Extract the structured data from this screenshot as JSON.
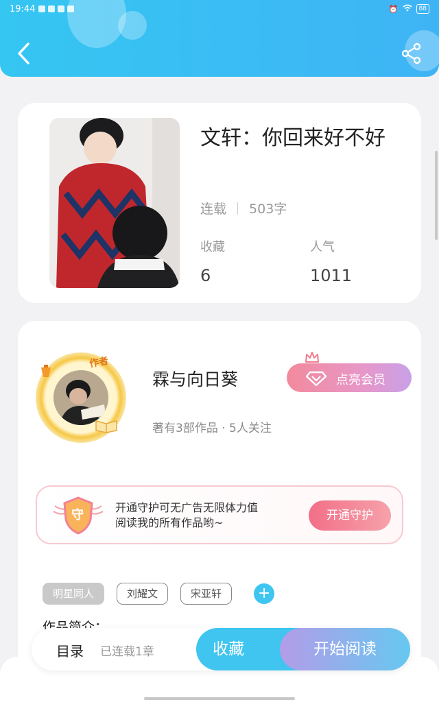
{
  "status_bar": {
    "time": "19:44"
  },
  "book": {
    "title": "文轩：你回来好不好",
    "status": "连载",
    "word_count": "503字",
    "favorites_label": "收藏",
    "favorites_value": "6",
    "popularity_label": "人气",
    "popularity_value": "1011"
  },
  "author": {
    "badge": "作者",
    "name": "霖与向日葵",
    "subtitle": "著有3部作品 · 5人关注",
    "vip_button": "点亮会员"
  },
  "guard": {
    "badge_char": "守",
    "line1": "开通守护可无广告无限体力值",
    "line2": "阅读我的所有作品哟~",
    "button": "开通守护"
  },
  "tags": [
    "明星同人",
    "刘耀文",
    "宋亚轩"
  ],
  "tag_add": "+",
  "intro_label": "作品简介：",
  "action_bar": {
    "toc": "目录",
    "toc_sub": "已连载1章",
    "collect": "收藏",
    "read": "开始阅读"
  },
  "colors": {
    "header": "#35c6f2",
    "accent_blue": "#3fc5ef",
    "pink": "#f26f87"
  }
}
